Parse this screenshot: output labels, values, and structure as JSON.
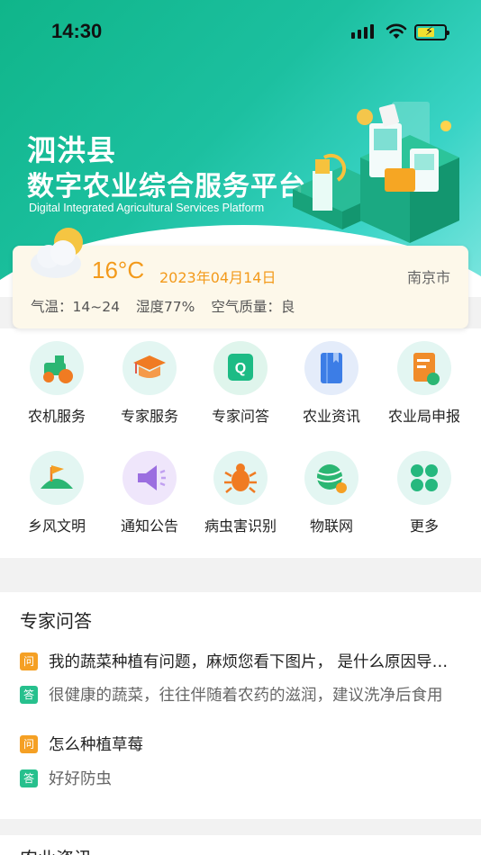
{
  "status_bar": {
    "time": "14:30"
  },
  "header": {
    "county": "泗洪县",
    "platform_title": "数字农业综合服务平台",
    "platform_subtitle": "Digital Integrated Agricultural Services Platform"
  },
  "weather": {
    "temperature": "16°C",
    "date": "2023年04月14日",
    "city": "南京市",
    "range": "气温：14~24",
    "humidity": "湿度77%",
    "air_quality": "空气质量：良"
  },
  "services": [
    {
      "label": "农机服务",
      "icon": "tractor-icon",
      "color": "#2bb673"
    },
    {
      "label": "专家服务",
      "icon": "graduation-cap-icon",
      "color": "#f0782a"
    },
    {
      "label": "专家问答",
      "icon": "q-chat-icon",
      "color": "#1dbb85"
    },
    {
      "label": "农业资讯",
      "icon": "book-icon",
      "color": "#3c7de6"
    },
    {
      "label": "农业局申报",
      "icon": "document-icon",
      "color": "#f08c2a"
    },
    {
      "label": "乡风文明",
      "icon": "flag-icon",
      "color": "#2bb673"
    },
    {
      "label": "通知公告",
      "icon": "megaphone-icon",
      "color": "#9b6ee0"
    },
    {
      "label": "病虫害识别",
      "icon": "bug-icon",
      "color": "#f07b22"
    },
    {
      "label": "物联网",
      "icon": "globe-icon",
      "color": "#2bb673"
    },
    {
      "label": "更多",
      "icon": "more-grid-icon",
      "color": "#25b87e"
    }
  ],
  "qa": {
    "title": "专家问答",
    "q_tag": "问",
    "a_tag": "答",
    "items": [
      {
        "question": "我的蔬菜种植有问题，麻烦您看下图片， 是什么原因导致的呢",
        "answer": "很健康的蔬菜，往往伴随着农药的滋润，建议洗净后食用"
      },
      {
        "question": "怎么种植草莓",
        "answer": "好好防虫"
      }
    ]
  },
  "news": {
    "title": "农业资讯"
  }
}
